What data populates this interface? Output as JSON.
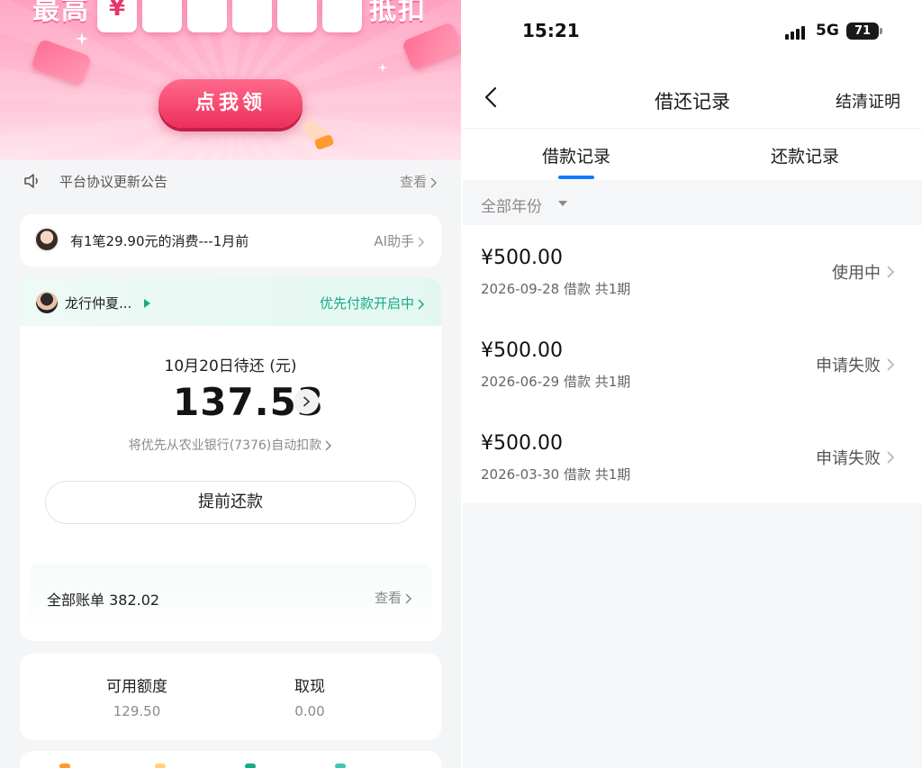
{
  "left": {
    "banner": {
      "big_left": "最高",
      "big_right": "抵扣",
      "digits": [
        "¥",
        "",
        "",
        "",
        "",
        ""
      ],
      "claim_button": "点我领"
    },
    "notice": {
      "text": "平台协议更新公告",
      "more": "查看"
    },
    "ai": {
      "text": "有1笔29.90元的消费---1月前",
      "link": "AI助手"
    },
    "bill": {
      "user_name": "龙行仲夏...",
      "pay_status": "优先付款开启中",
      "due_label": "10月20日待还 (元)",
      "due_amount": "137.53",
      "auto_debit": "将优先从农业银行(7376)自动扣款",
      "prepay_button": "提前还款",
      "all_bills_label": "全部账单 382.02",
      "all_bills_more": "查看"
    },
    "limits": [
      {
        "label": "可用额度",
        "value": "129.50"
      },
      {
        "label": "取现",
        "value": "0.00"
      }
    ]
  },
  "right": {
    "status": {
      "time": "15:21",
      "network": "5G",
      "battery": "71"
    },
    "nav": {
      "title": "借还记录",
      "right_link": "结清证明"
    },
    "tabs": [
      {
        "label": "借款记录",
        "active": true
      },
      {
        "label": "还款记录",
        "active": false
      }
    ],
    "filter": "全部年份",
    "records": [
      {
        "amount": "¥500.00",
        "detail": "2026-09-28 借款 共1期",
        "status": "使用中"
      },
      {
        "amount": "¥500.00",
        "detail": "2026-06-29 借款 共1期",
        "status": "申请失败"
      },
      {
        "amount": "¥500.00",
        "detail": "2026-03-30 借款 共1期",
        "status": "申请失败"
      }
    ]
  },
  "colors": {
    "accent_green": "#19a98a",
    "accent_blue": "#1677ff",
    "banner_pink": "#ff9fc0",
    "claim_red": "#ee2f5c"
  }
}
